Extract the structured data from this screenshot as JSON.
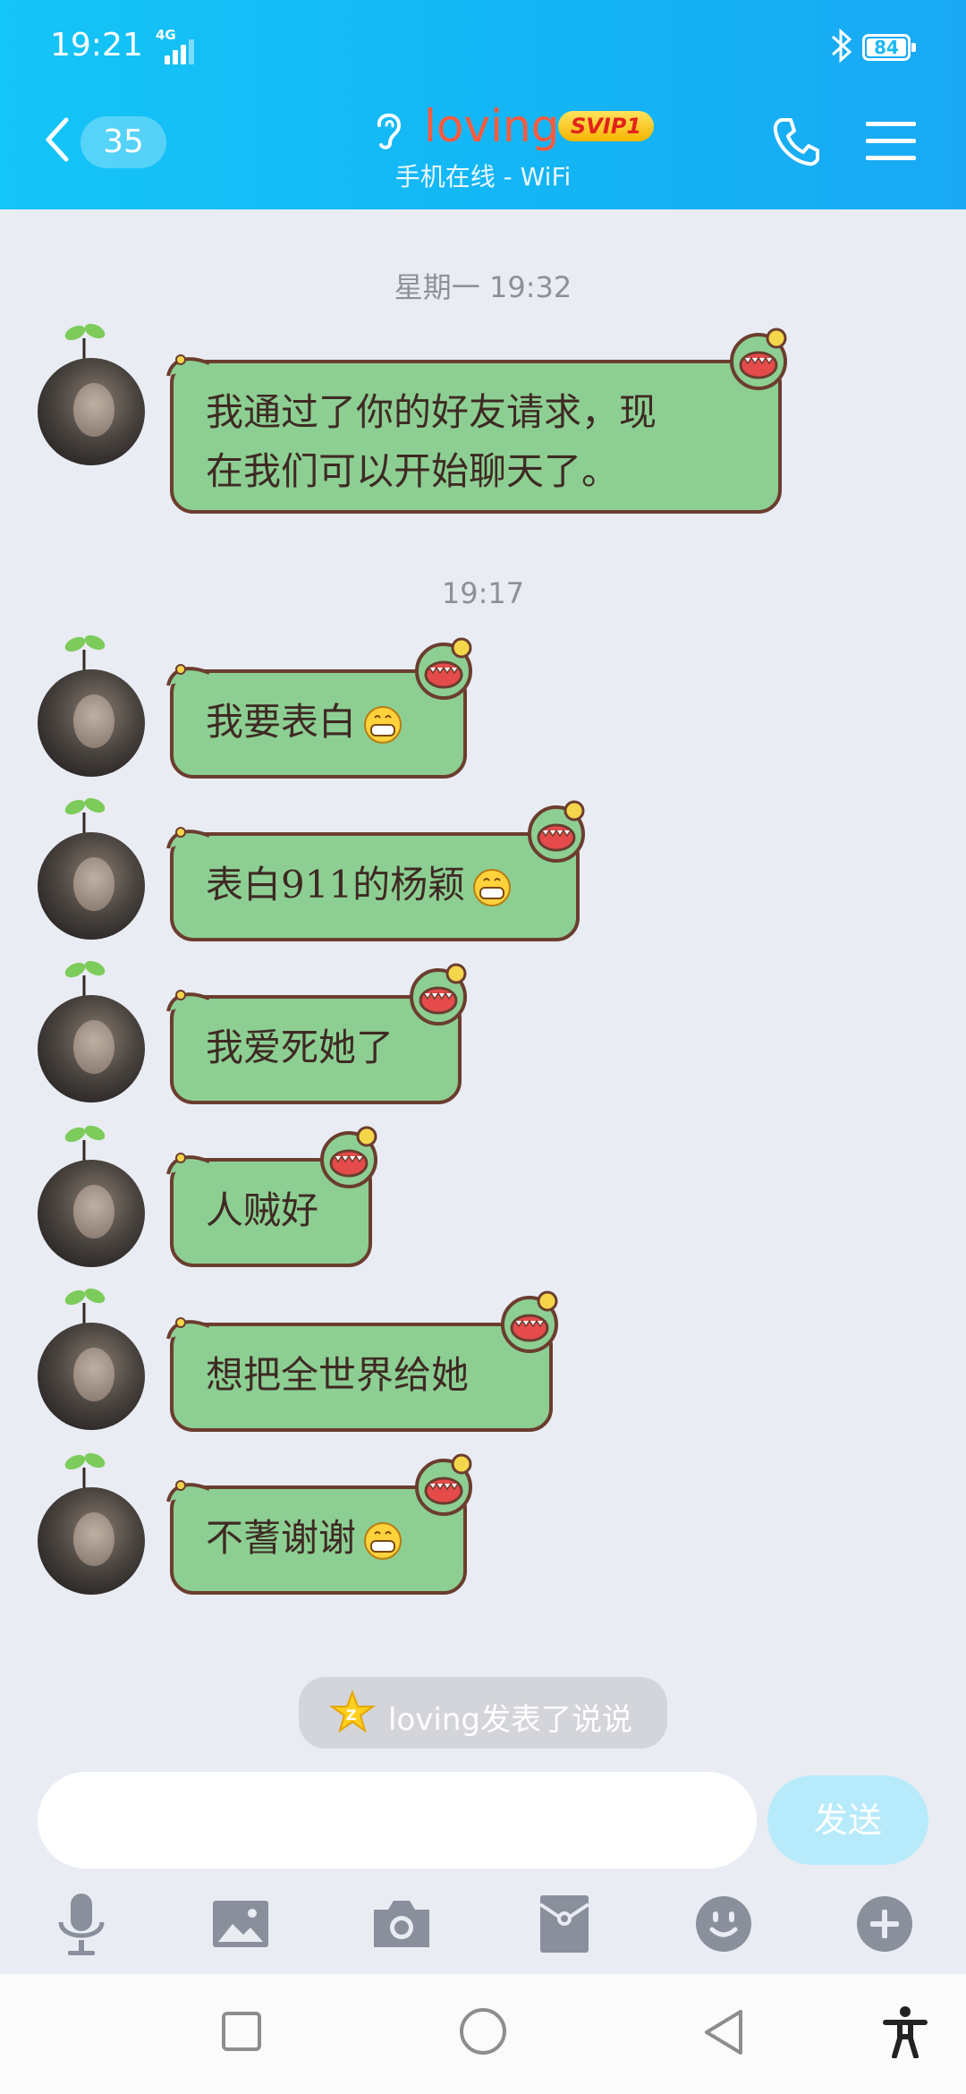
{
  "status_bar": {
    "time": "19:21",
    "network": "4G",
    "battery": "84"
  },
  "header": {
    "unread_count": "35",
    "contact_name": "loving",
    "badge": "SVIP1",
    "online_status": "手机在线 - WiFi"
  },
  "chat": {
    "timestamp_1": "星期一 19:32",
    "timestamp_2": "19:17",
    "messages": [
      {
        "line1": "我通过了你的好友请求，现",
        "line2": "在我们可以开始聊天了。"
      },
      {
        "text": "我要表白",
        "emoji": "grin"
      },
      {
        "text": "表白911的杨颖",
        "emoji": "grin"
      },
      {
        "text": "我爱死她了"
      },
      {
        "text": "人贼好"
      },
      {
        "text": "想把全世界给她"
      },
      {
        "text": "不蓍谢谢",
        "emoji": "grin"
      }
    ]
  },
  "notice": {
    "text": "loving发表了说说"
  },
  "composer": {
    "input_value": "",
    "send_label": "发送"
  },
  "toolbar_icons": [
    "microphone-icon",
    "image-icon",
    "camera-icon",
    "red-packet-icon",
    "emoji-icon",
    "plus-icon"
  ],
  "colors": {
    "header": "#14b4f5",
    "bubble": "#8dcf93",
    "bubble_border": "#6b3d2f",
    "name": "#ff5a3d"
  }
}
